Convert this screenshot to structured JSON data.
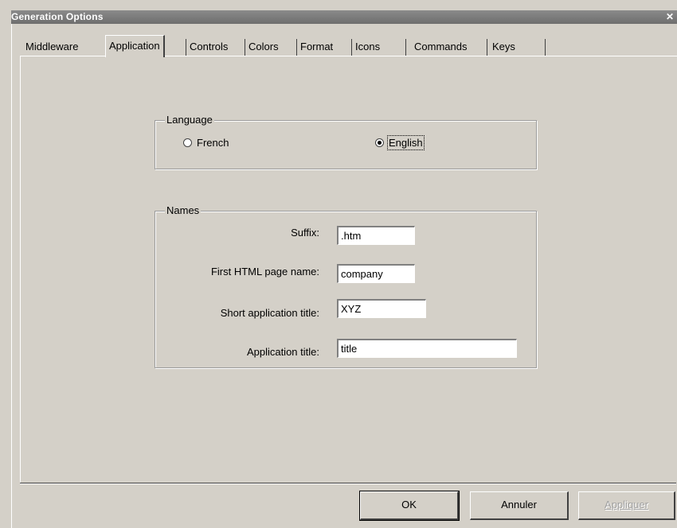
{
  "window": {
    "title": "Generation Options",
    "close_glyph": "✕"
  },
  "tabs": [
    {
      "label": "Middleware"
    },
    {
      "label": "Application",
      "active": true
    },
    {
      "label": "Controls"
    },
    {
      "label": "Colors"
    },
    {
      "label": "Format"
    },
    {
      "label": "Icons"
    },
    {
      "label": "Commands"
    },
    {
      "label": "Keys"
    }
  ],
  "language_group": {
    "label": "Language",
    "options": [
      {
        "label": "French",
        "selected": false
      },
      {
        "label": "English",
        "selected": true
      }
    ]
  },
  "names_group": {
    "label": "Names",
    "fields": [
      {
        "label": "Suffix:",
        "value": ".htm"
      },
      {
        "label": "First HTML page name:",
        "value": "company"
      },
      {
        "label": "Short application title:",
        "value": "XYZ"
      },
      {
        "label": "Application title:",
        "value": "title"
      }
    ]
  },
  "buttons": {
    "ok": "OK",
    "cancel": "Annuler",
    "apply": "Appliquer"
  },
  "icons": {
    "close": "close-icon",
    "radio": "radio-button"
  },
  "colors": {
    "face": "#d4d0c8",
    "shadow": "#404040",
    "highlight": "#ffffff"
  }
}
